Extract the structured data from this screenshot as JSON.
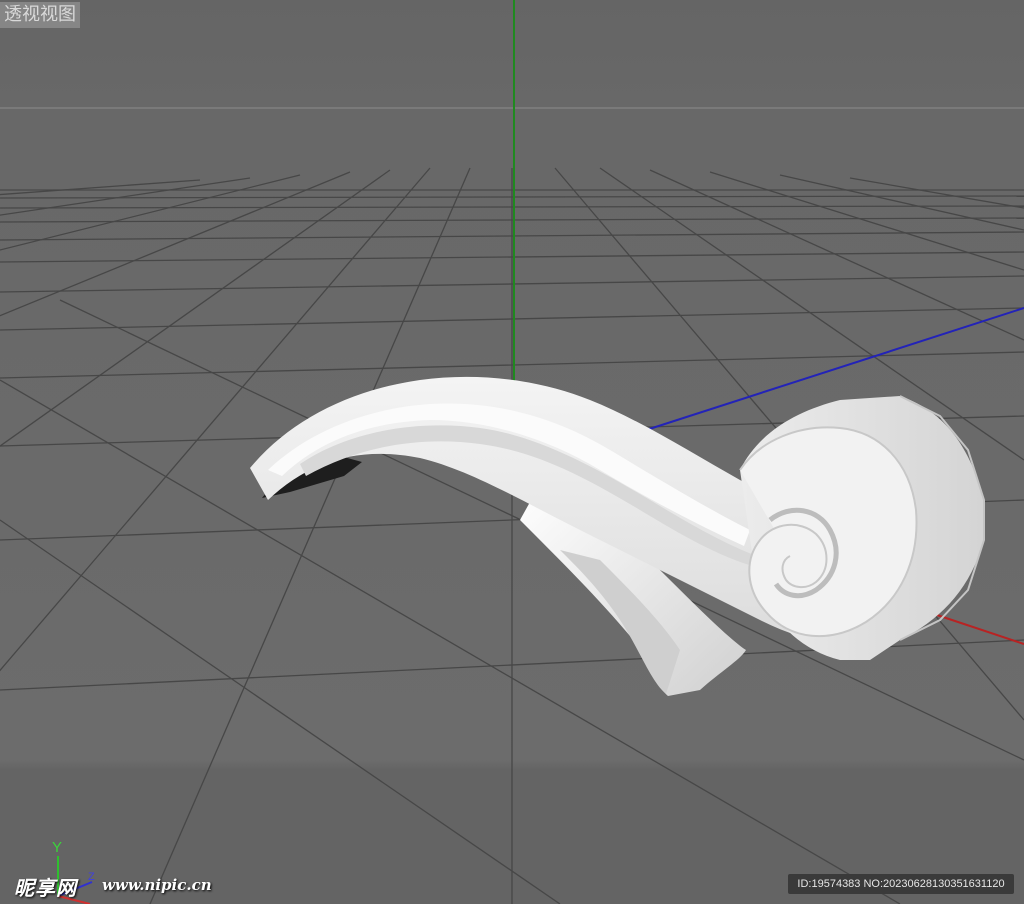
{
  "viewport": {
    "view_label": "透视视图",
    "colors": {
      "background": "#686868",
      "grid_line": "#4a4a4a",
      "horizon_line": "#7a7a7a",
      "axis_y": "#1f8a1f",
      "axis_z": "#2323b8",
      "axis_x": "#b82323",
      "object": "#e6e6e6"
    }
  },
  "axis_gizmo": {
    "y_label": "Y",
    "z_label": "Z",
    "icon": "xyz-axis-gizmo-icon"
  },
  "watermark": {
    "logo_text": "昵享网",
    "url_text": "www.nipic.cn",
    "id_text": "ID:19574383 NO:20230628130351631120"
  },
  "scene": {
    "object_name": "scroll-ornament-3d-model",
    "object_icon": "scroll-curl-shape"
  }
}
